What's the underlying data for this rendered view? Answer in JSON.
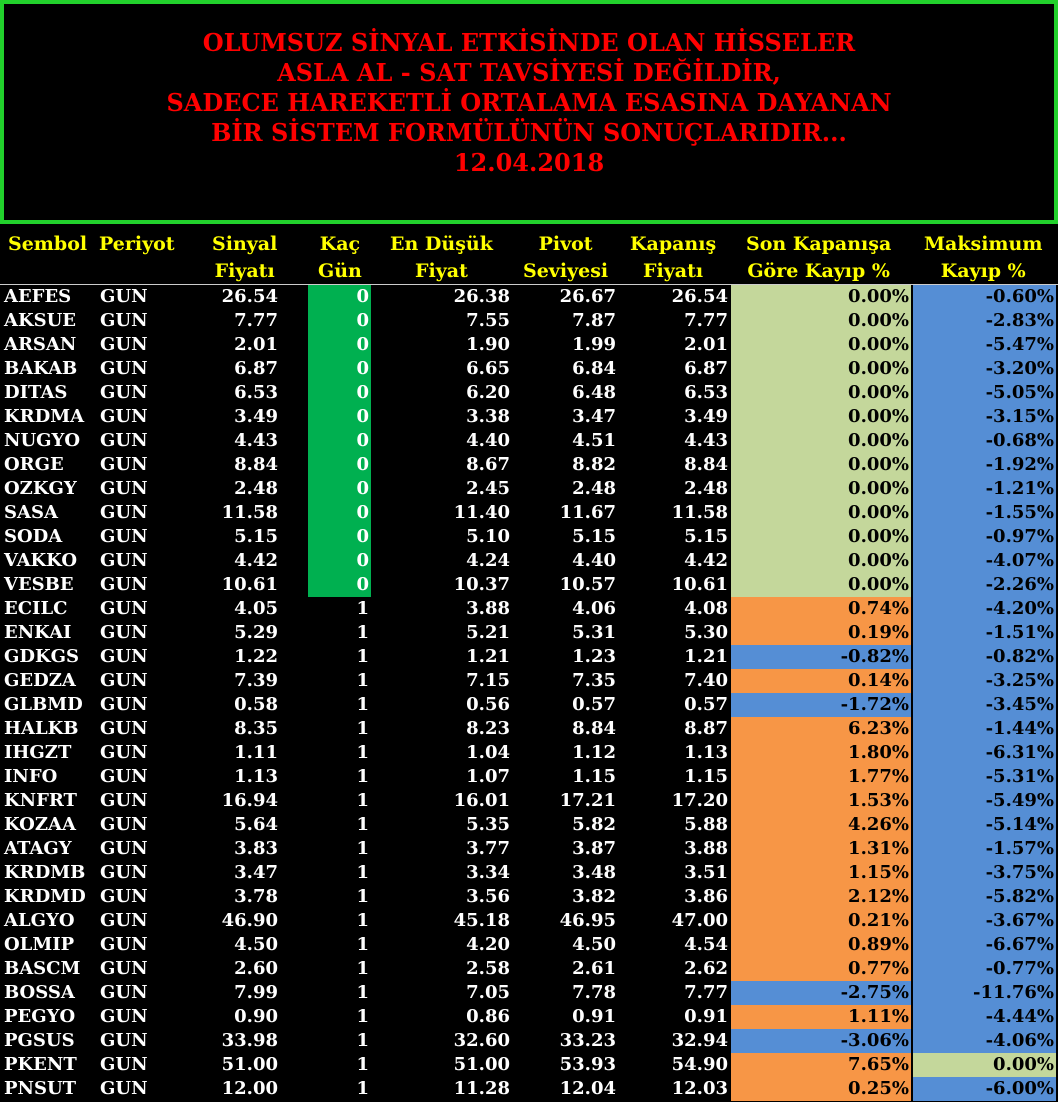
{
  "banner": {
    "lines": [
      "OLUMSUZ SİNYAL ETKİSİNDE OLAN HİSSELER",
      "ASLA AL - SAT TAVSİYESİ DEĞİLDİR,",
      "SADECE HAREKETLİ ORTALAMA ESASINA DAYANAN",
      "BİR SİSTEM FORMÜLÜNÜN SONUÇLARIDIR...",
      "12.04.2018"
    ]
  },
  "headers": {
    "sembol": "Sembol",
    "periyot": "Periyot",
    "sinyal": [
      "Sinyal",
      "Fiyatı"
    ],
    "kac": [
      "Kaç",
      "Gün"
    ],
    "endusuk": [
      "En Düşük",
      "Fiyat"
    ],
    "pivot": [
      "Pivot",
      "Seviyesi"
    ],
    "kapanis": [
      "Kapanış",
      "Fiyatı"
    ],
    "sonkayip": [
      "Son Kapanışa",
      "Göre Kayıp %"
    ],
    "maxkayip": [
      "Maksimum",
      "Kayıp %"
    ]
  },
  "colors": {
    "banner_border": "#22d12c",
    "banner_text": "#ff0000",
    "header_text": "#ffff00",
    "days_zero": "#00b050",
    "light_green": "#c4d79b",
    "orange": "#f79646",
    "blue": "#558ed5"
  },
  "rows": [
    {
      "sym": "AEFES",
      "per": "GUN",
      "sig": "26.54",
      "days": "0",
      "low": "26.38",
      "piv": "26.67",
      "cls": "26.54",
      "loss": "0.00%",
      "maxl": "-0.60%",
      "lossColor": "green",
      "maxColor": "blue"
    },
    {
      "sym": "AKSUE",
      "per": "GUN",
      "sig": "7.77",
      "days": "0",
      "low": "7.55",
      "piv": "7.87",
      "cls": "7.77",
      "loss": "0.00%",
      "maxl": "-2.83%",
      "lossColor": "green",
      "maxColor": "blue"
    },
    {
      "sym": "ARSAN",
      "per": "GUN",
      "sig": "2.01",
      "days": "0",
      "low": "1.90",
      "piv": "1.99",
      "cls": "2.01",
      "loss": "0.00%",
      "maxl": "-5.47%",
      "lossColor": "green",
      "maxColor": "blue"
    },
    {
      "sym": "BAKAB",
      "per": "GUN",
      "sig": "6.87",
      "days": "0",
      "low": "6.65",
      "piv": "6.84",
      "cls": "6.87",
      "loss": "0.00%",
      "maxl": "-3.20%",
      "lossColor": "green",
      "maxColor": "blue"
    },
    {
      "sym": "DITAS",
      "per": "GUN",
      "sig": "6.53",
      "days": "0",
      "low": "6.20",
      "piv": "6.48",
      "cls": "6.53",
      "loss": "0.00%",
      "maxl": "-5.05%",
      "lossColor": "green",
      "maxColor": "blue"
    },
    {
      "sym": "KRDMA",
      "per": "GUN",
      "sig": "3.49",
      "days": "0",
      "low": "3.38",
      "piv": "3.47",
      "cls": "3.49",
      "loss": "0.00%",
      "maxl": "-3.15%",
      "lossColor": "green",
      "maxColor": "blue"
    },
    {
      "sym": "NUGYO",
      "per": "GUN",
      "sig": "4.43",
      "days": "0",
      "low": "4.40",
      "piv": "4.51",
      "cls": "4.43",
      "loss": "0.00%",
      "maxl": "-0.68%",
      "lossColor": "green",
      "maxColor": "blue"
    },
    {
      "sym": "ORGE",
      "per": "GUN",
      "sig": "8.84",
      "days": "0",
      "low": "8.67",
      "piv": "8.82",
      "cls": "8.84",
      "loss": "0.00%",
      "maxl": "-1.92%",
      "lossColor": "green",
      "maxColor": "blue"
    },
    {
      "sym": "OZKGY",
      "per": "GUN",
      "sig": "2.48",
      "days": "0",
      "low": "2.45",
      "piv": "2.48",
      "cls": "2.48",
      "loss": "0.00%",
      "maxl": "-1.21%",
      "lossColor": "green",
      "maxColor": "blue"
    },
    {
      "sym": "SASA",
      "per": "GUN",
      "sig": "11.58",
      "days": "0",
      "low": "11.40",
      "piv": "11.67",
      "cls": "11.58",
      "loss": "0.00%",
      "maxl": "-1.55%",
      "lossColor": "green",
      "maxColor": "blue"
    },
    {
      "sym": "SODA",
      "per": "GUN",
      "sig": "5.15",
      "days": "0",
      "low": "5.10",
      "piv": "5.15",
      "cls": "5.15",
      "loss": "0.00%",
      "maxl": "-0.97%",
      "lossColor": "green",
      "maxColor": "blue"
    },
    {
      "sym": "VAKKO",
      "per": "GUN",
      "sig": "4.42",
      "days": "0",
      "low": "4.24",
      "piv": "4.40",
      "cls": "4.42",
      "loss": "0.00%",
      "maxl": "-4.07%",
      "lossColor": "green",
      "maxColor": "blue"
    },
    {
      "sym": "VESBE",
      "per": "GUN",
      "sig": "10.61",
      "days": "0",
      "low": "10.37",
      "piv": "10.57",
      "cls": "10.61",
      "loss": "0.00%",
      "maxl": "-2.26%",
      "lossColor": "green",
      "maxColor": "blue"
    },
    {
      "sym": "ECILC",
      "per": "GUN",
      "sig": "4.05",
      "days": "1",
      "low": "3.88",
      "piv": "4.06",
      "cls": "4.08",
      "loss": "0.74%",
      "maxl": "-4.20%",
      "lossColor": "orange",
      "maxColor": "blue"
    },
    {
      "sym": "ENKAI",
      "per": "GUN",
      "sig": "5.29",
      "days": "1",
      "low": "5.21",
      "piv": "5.31",
      "cls": "5.30",
      "loss": "0.19%",
      "maxl": "-1.51%",
      "lossColor": "orange",
      "maxColor": "blue"
    },
    {
      "sym": "GDKGS",
      "per": "GUN",
      "sig": "1.22",
      "days": "1",
      "low": "1.21",
      "piv": "1.23",
      "cls": "1.21",
      "loss": "-0.82%",
      "maxl": "-0.82%",
      "lossColor": "blue",
      "maxColor": "blue"
    },
    {
      "sym": "GEDZA",
      "per": "GUN",
      "sig": "7.39",
      "days": "1",
      "low": "7.15",
      "piv": "7.35",
      "cls": "7.40",
      "loss": "0.14%",
      "maxl": "-3.25%",
      "lossColor": "orange",
      "maxColor": "blue"
    },
    {
      "sym": "GLBMD",
      "per": "GUN",
      "sig": "0.58",
      "days": "1",
      "low": "0.56",
      "piv": "0.57",
      "cls": "0.57",
      "loss": "-1.72%",
      "maxl": "-3.45%",
      "lossColor": "blue",
      "maxColor": "blue"
    },
    {
      "sym": "HALKB",
      "per": "GUN",
      "sig": "8.35",
      "days": "1",
      "low": "8.23",
      "piv": "8.84",
      "cls": "8.87",
      "loss": "6.23%",
      "maxl": "-1.44%",
      "lossColor": "orange",
      "maxColor": "blue"
    },
    {
      "sym": "IHGZT",
      "per": "GUN",
      "sig": "1.11",
      "days": "1",
      "low": "1.04",
      "piv": "1.12",
      "cls": "1.13",
      "loss": "1.80%",
      "maxl": "-6.31%",
      "lossColor": "orange",
      "maxColor": "blue"
    },
    {
      "sym": "INFO",
      "per": "GUN",
      "sig": "1.13",
      "days": "1",
      "low": "1.07",
      "piv": "1.15",
      "cls": "1.15",
      "loss": "1.77%",
      "maxl": "-5.31%",
      "lossColor": "orange",
      "maxColor": "blue"
    },
    {
      "sym": "KNFRT",
      "per": "GUN",
      "sig": "16.94",
      "days": "1",
      "low": "16.01",
      "piv": "17.21",
      "cls": "17.20",
      "loss": "1.53%",
      "maxl": "-5.49%",
      "lossColor": "orange",
      "maxColor": "blue"
    },
    {
      "sym": "KOZAA",
      "per": "GUN",
      "sig": "5.64",
      "days": "1",
      "low": "5.35",
      "piv": "5.82",
      "cls": "5.88",
      "loss": "4.26%",
      "maxl": "-5.14%",
      "lossColor": "orange",
      "maxColor": "blue"
    },
    {
      "sym": "ATAGY",
      "per": "GUN",
      "sig": "3.83",
      "days": "1",
      "low": "3.77",
      "piv": "3.87",
      "cls": "3.88",
      "loss": "1.31%",
      "maxl": "-1.57%",
      "lossColor": "orange",
      "maxColor": "blue"
    },
    {
      "sym": "KRDMB",
      "per": "GUN",
      "sig": "3.47",
      "days": "1",
      "low": "3.34",
      "piv": "3.48",
      "cls": "3.51",
      "loss": "1.15%",
      "maxl": "-3.75%",
      "lossColor": "orange",
      "maxColor": "blue"
    },
    {
      "sym": "KRDMD",
      "per": "GUN",
      "sig": "3.78",
      "days": "1",
      "low": "3.56",
      "piv": "3.82",
      "cls": "3.86",
      "loss": "2.12%",
      "maxl": "-5.82%",
      "lossColor": "orange",
      "maxColor": "blue"
    },
    {
      "sym": "ALGYO",
      "per": "GUN",
      "sig": "46.90",
      "days": "1",
      "low": "45.18",
      "piv": "46.95",
      "cls": "47.00",
      "loss": "0.21%",
      "maxl": "-3.67%",
      "lossColor": "orange",
      "maxColor": "blue"
    },
    {
      "sym": "OLMIP",
      "per": "GUN",
      "sig": "4.50",
      "days": "1",
      "low": "4.20",
      "piv": "4.50",
      "cls": "4.54",
      "loss": "0.89%",
      "maxl": "-6.67%",
      "lossColor": "orange",
      "maxColor": "blue"
    },
    {
      "sym": "BASCM",
      "per": "GUN",
      "sig": "2.60",
      "days": "1",
      "low": "2.58",
      "piv": "2.61",
      "cls": "2.62",
      "loss": "0.77%",
      "maxl": "-0.77%",
      "lossColor": "orange",
      "maxColor": "blue"
    },
    {
      "sym": "BOSSA",
      "per": "GUN",
      "sig": "7.99",
      "days": "1",
      "low": "7.05",
      "piv": "7.78",
      "cls": "7.77",
      "loss": "-2.75%",
      "maxl": "-11.76%",
      "lossColor": "blue",
      "maxColor": "blue"
    },
    {
      "sym": "PEGYO",
      "per": "GUN",
      "sig": "0.90",
      "days": "1",
      "low": "0.86",
      "piv": "0.91",
      "cls": "0.91",
      "loss": "1.11%",
      "maxl": "-4.44%",
      "lossColor": "orange",
      "maxColor": "blue"
    },
    {
      "sym": "PGSUS",
      "per": "GUN",
      "sig": "33.98",
      "days": "1",
      "low": "32.60",
      "piv": "33.23",
      "cls": "32.94",
      "loss": "-3.06%",
      "maxl": "-4.06%",
      "lossColor": "blue",
      "maxColor": "blue"
    },
    {
      "sym": "PKENT",
      "per": "GUN",
      "sig": "51.00",
      "days": "1",
      "low": "51.00",
      "piv": "53.93",
      "cls": "54.90",
      "loss": "7.65%",
      "maxl": "0.00%",
      "lossColor": "orange",
      "maxColor": "green"
    },
    {
      "sym": "PNSUT",
      "per": "GUN",
      "sig": "12.00",
      "days": "1",
      "low": "11.28",
      "piv": "12.04",
      "cls": "12.03",
      "loss": "0.25%",
      "maxl": "-6.00%",
      "lossColor": "orange",
      "maxColor": "blue"
    }
  ]
}
